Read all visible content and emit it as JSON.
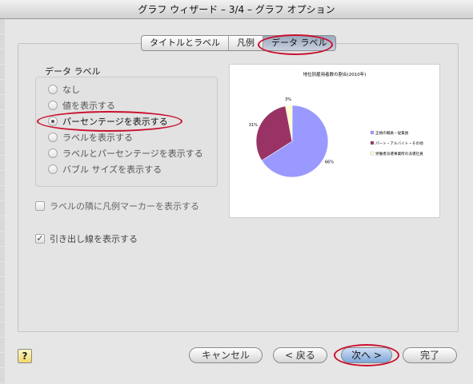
{
  "window": {
    "title": "グラフ ウィザード – 3/4 – グラフ オプション"
  },
  "tabs": [
    {
      "label": "タイトルとラベル",
      "active": false
    },
    {
      "label": "凡例",
      "active": false
    },
    {
      "label": "データ ラベル",
      "active": true
    }
  ],
  "data_labels": {
    "group_title": "データ ラベル",
    "options": [
      {
        "label": "なし",
        "selected": false
      },
      {
        "label": "値を表示する",
        "selected": false
      },
      {
        "label": "パーセンテージを表示する",
        "selected": true
      },
      {
        "label": "ラベルを表示する",
        "selected": false
      },
      {
        "label": "ラベルとパーセンテージを表示する",
        "selected": false
      },
      {
        "label": "バブル サイズを表示する",
        "selected": false
      }
    ]
  },
  "checkboxes": {
    "legend_key": {
      "label": "ラベルの隣に凡例マーカーを表示する",
      "checked": false
    },
    "leader_lines": {
      "label": "引き出し線を表示する",
      "checked": true
    }
  },
  "preview": {
    "chart_data": {
      "type": "pie",
      "title": "地位別雇用者数の割合(2010年)",
      "categories": [
        "正規の職員・従業員",
        "パート・アルバイト・その他",
        "労働者派遣事業所の派遣社員"
      ],
      "values": [
        66,
        31,
        3
      ],
      "data_labels": [
        "66%",
        "31%",
        "3%"
      ],
      "colors": [
        "#9999ff",
        "#993366",
        "#ffffcc"
      ],
      "legend_position": "right"
    }
  },
  "buttons": {
    "help": "?",
    "cancel": "キャンセル",
    "back": "< 戻る",
    "next": "次へ >",
    "finish": "完了"
  },
  "annotation_color": "#c8102e"
}
